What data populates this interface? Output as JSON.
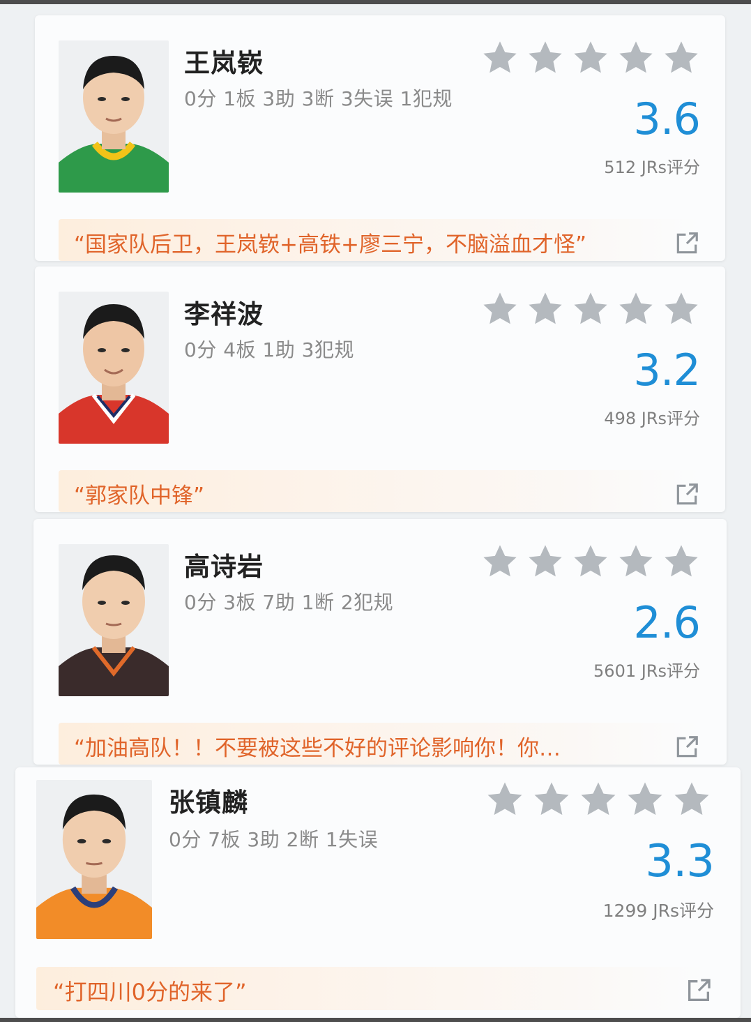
{
  "colors": {
    "score": "#1f8ed6",
    "star": "#b4b9be",
    "comment_text": "#e0642a",
    "comment_bg": "#fdeedd",
    "stats": "#8a8a8a"
  },
  "players": [
    {
      "name": "王岚嵚",
      "stats": "0分 1板 3助 3断 3失误 1犯规",
      "score": "3.6",
      "votes": "512 JRs评分",
      "comment": "“国家队后卫，王岚嵚+高铁+廖三宁，不脑溢血才怪”",
      "jersey": "#2e9a4a",
      "jersey_trim": "#f2c318",
      "rating_stars": 0
    },
    {
      "name": "李祥波",
      "stats": "0分 4板 1助 3犯规",
      "score": "3.2",
      "votes": "498 JRs评分",
      "comment": "“郭家队中锋”",
      "jersey": "#d8362b",
      "jersey_trim": "#ffffff",
      "rating_stars": 0
    },
    {
      "name": "高诗岩",
      "stats": "0分 3板 7助 1断 2犯规",
      "score": "2.6",
      "votes": "5601 JRs评分",
      "comment": "“加油高队！！不要被这些不好的评论影响你！你…",
      "jersey": "#3a2b2b",
      "jersey_trim": "#e06a2a",
      "rating_stars": 0
    },
    {
      "name": "张镇麟",
      "stats": "0分 7板 3助 2断 1失误",
      "score": "3.3",
      "votes": "1299 JRs评分",
      "comment": "“打四川0分的来了”",
      "jersey": "#f28c28",
      "jersey_trim": "#2c3f7a",
      "rating_stars": 0
    }
  ]
}
